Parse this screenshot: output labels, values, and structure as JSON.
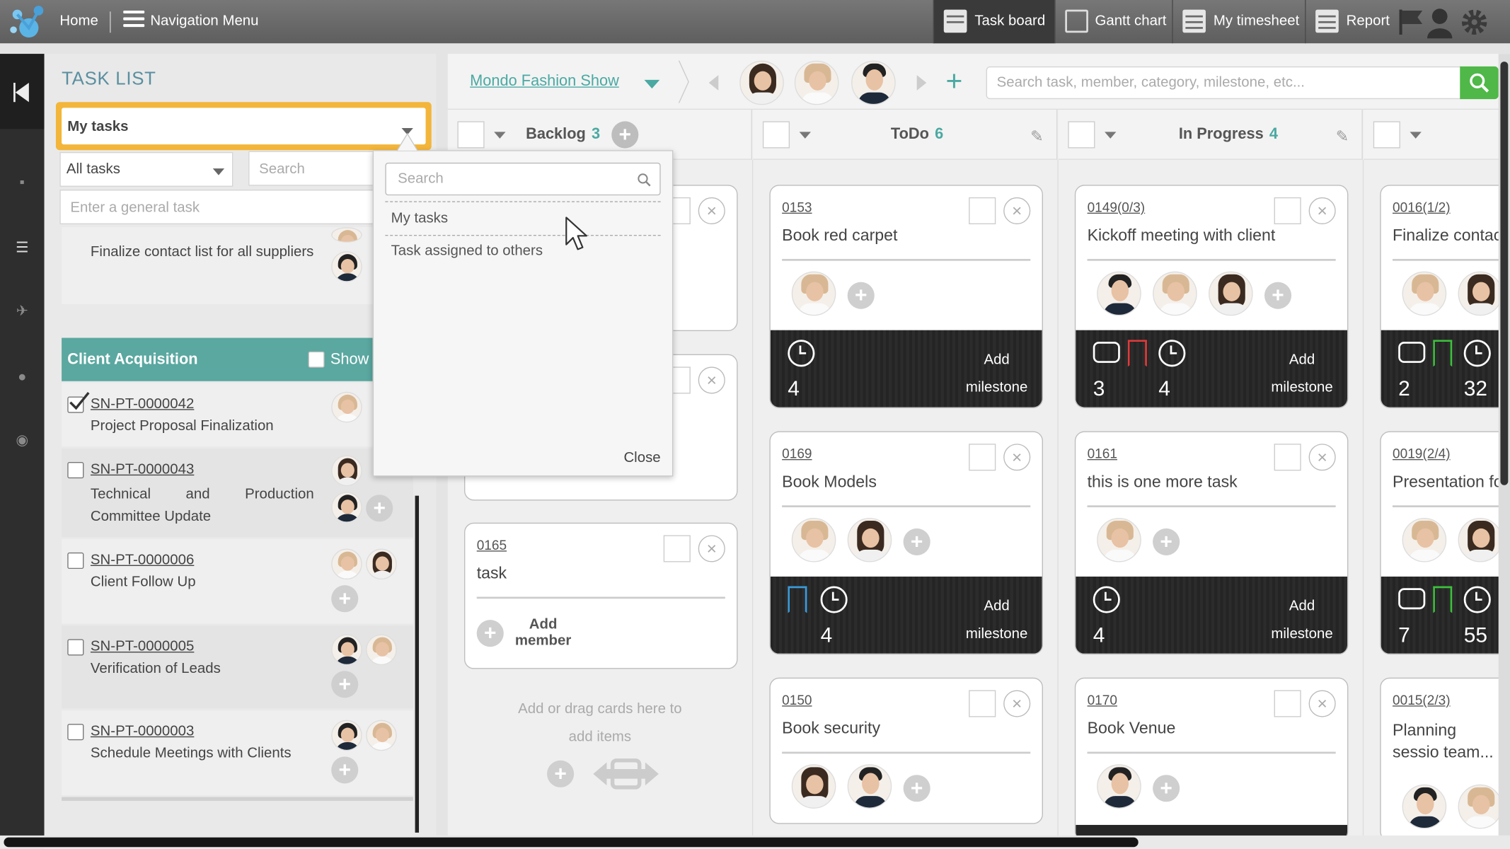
{
  "topbar": {
    "home": "Home",
    "nav_menu": "Navigation Menu",
    "tabs": [
      {
        "label": "Task board",
        "active": true
      },
      {
        "label": "Gantt chart",
        "active": false
      },
      {
        "label": "My timesheet",
        "active": false
      },
      {
        "label": "Report",
        "active": false
      }
    ]
  },
  "task_list": {
    "title": "TASK LIST",
    "filter_selected": "My tasks",
    "scope_selected": "All tasks",
    "search_placeholder": "Search",
    "general_task_placeholder": "Enter a general task",
    "partial_task": "Finalize contact list for all suppliers",
    "group": {
      "name": "Client Acquisition",
      "show_label": "Show"
    },
    "items": [
      {
        "id": "SN-PT-0000042",
        "title": "Project Proposal Finalization",
        "checked": true
      },
      {
        "id": "SN-PT-0000043",
        "title": "Technical and Production Committee Update",
        "checked": false
      },
      {
        "id": "SN-PT-0000006",
        "title": "Client Follow Up",
        "checked": false
      },
      {
        "id": "SN-PT-0000005",
        "title": "Verification of Leads",
        "checked": false
      },
      {
        "id": "SN-PT-0000003",
        "title": "Schedule Meetings with Clients",
        "checked": false
      }
    ]
  },
  "dropdown": {
    "search_placeholder": "Search",
    "options": [
      "My tasks",
      "Task assigned to others"
    ],
    "close": "Close"
  },
  "board": {
    "project": "Mondo Fashion Show",
    "search_placeholder": "Search task, member, category, milestone, etc...",
    "columns": [
      {
        "title": "Backlog",
        "count": "3"
      },
      {
        "title": "ToDo",
        "count": "6"
      },
      {
        "title": "In Progress",
        "count": "4"
      }
    ],
    "backlog_card": {
      "id": "0165",
      "name": "task",
      "add_member": "Add member"
    },
    "backlog_hint": "Add or drag cards here to add items",
    "todo": [
      {
        "id": "0153",
        "name": "Book red carpet",
        "clock": "4",
        "add_milestone": "Add milestone"
      },
      {
        "id": "0169",
        "name": "Book Models",
        "clock": "4",
        "add_milestone": "Add milestone"
      },
      {
        "id": "0150",
        "name": "Book security"
      }
    ],
    "inprogress": [
      {
        "id": "0149(0/3)",
        "name": "Kickoff meeting with client",
        "comments": "3",
        "clock": "4",
        "add_milestone": "Add milestone"
      },
      {
        "id": "0161",
        "name": "this is one more task",
        "clock": "4",
        "add_milestone": "Add milestone"
      },
      {
        "id": "0170",
        "name": "Book Venue"
      }
    ],
    "fourth": [
      {
        "id": "0016(1/2)",
        "name": "Finalize contac",
        "comments": "2",
        "clock": "32"
      },
      {
        "id": "0019(2/4)",
        "name": "Presentation fo",
        "comments": "7",
        "clock": "55"
      },
      {
        "id": "0015(2/3)",
        "name": "Planning sessio team..."
      }
    ]
  },
  "colors": {
    "accent": "#4aa9a2",
    "highlight": "#f3b53a",
    "bookmark_red": "#e23a3a",
    "bookmark_green": "#3cc23c",
    "bookmark_blue": "#3a9ad9"
  }
}
